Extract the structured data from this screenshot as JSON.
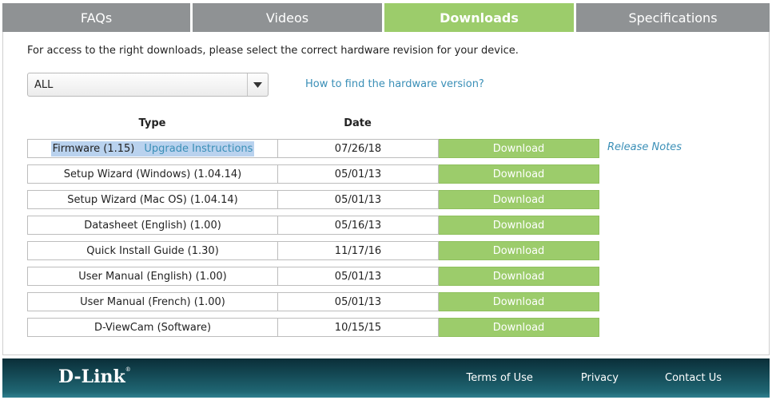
{
  "tabs": [
    {
      "label": "FAQs",
      "active": false
    },
    {
      "label": "Videos",
      "active": false
    },
    {
      "label": "Downloads",
      "active": true
    },
    {
      "label": "Specifications",
      "active": false
    }
  ],
  "intro_text": "For access to the right downloads, please select the correct hardware revision for your device.",
  "revision_select": {
    "value": "ALL"
  },
  "howto_link": "How to find the hardware version?",
  "table": {
    "headers": {
      "type": "Type",
      "date": "Date"
    },
    "download_label": "Download",
    "rows": [
      {
        "type": "Firmware (1.15)",
        "extra_link": "Upgrade Instructions",
        "date": "07/26/18",
        "notes": "Release Notes"
      },
      {
        "type": "Setup Wizard (Windows) (1.04.14)",
        "date": "05/01/13"
      },
      {
        "type": "Setup Wizard (Mac OS) (1.04.14)",
        "date": "05/01/13"
      },
      {
        "type": "Datasheet (English) (1.00)",
        "date": "05/16/13"
      },
      {
        "type": "Quick Install Guide (1.30)",
        "date": "11/17/16"
      },
      {
        "type": "User Manual (English) (1.00)",
        "date": "05/01/13"
      },
      {
        "type": "User Manual (French) (1.00)",
        "date": "05/01/13"
      },
      {
        "type": "D-ViewCam (Software)",
        "date": "10/15/15"
      }
    ]
  },
  "footer": {
    "logo": "D-Link",
    "links": [
      "Terms of Use",
      "Privacy",
      "Contact Us"
    ]
  },
  "colors": {
    "accent_green": "#9ccc6b",
    "tab_gray": "#8f9294",
    "link_blue": "#3a8fb7",
    "footer_teal": "#1f6673"
  }
}
